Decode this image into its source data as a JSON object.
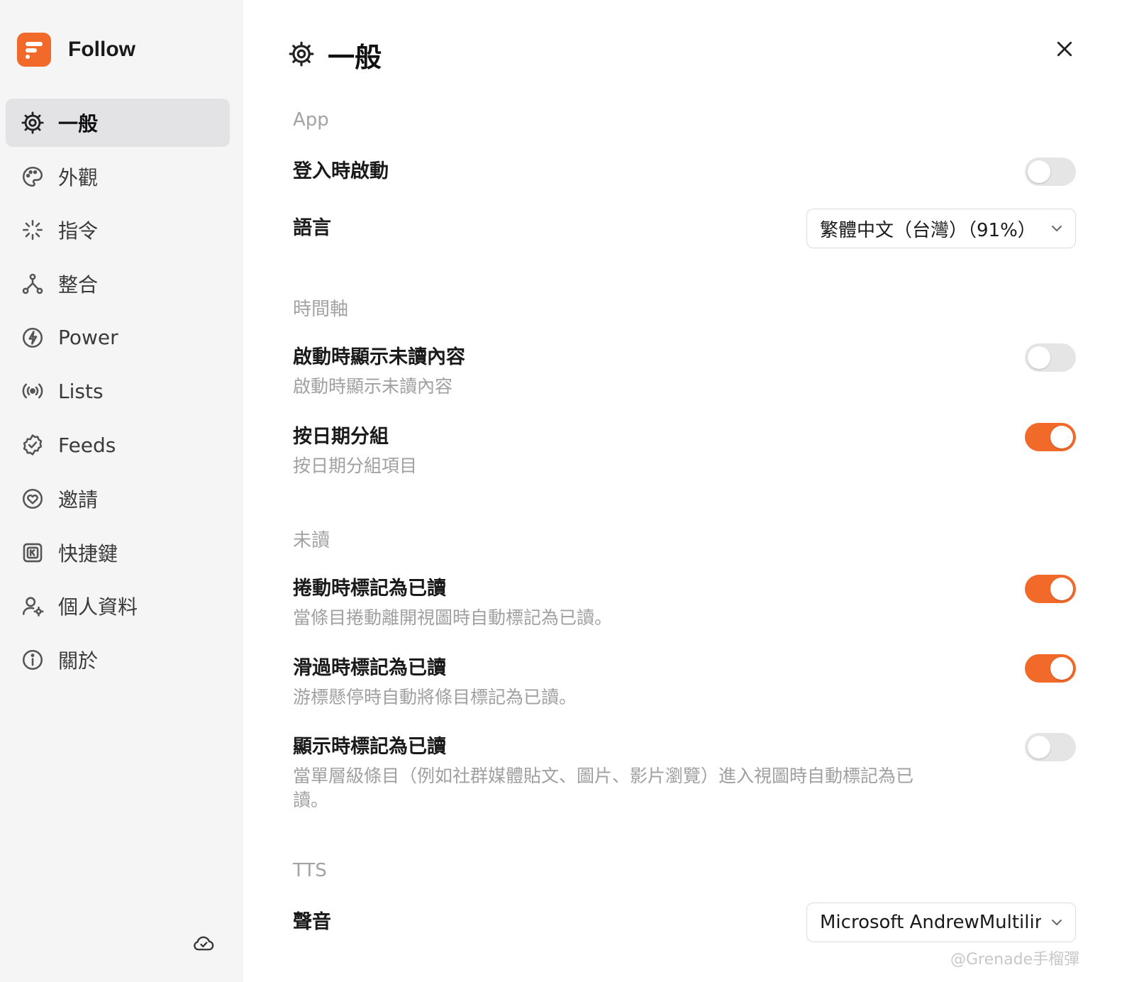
{
  "brand": {
    "name": "Follow"
  },
  "sidebar": {
    "items": [
      {
        "label": "一般",
        "icon": "gear-icon",
        "active": true
      },
      {
        "label": "外觀",
        "icon": "palette-icon"
      },
      {
        "label": "指令",
        "icon": "sparkle-icon"
      },
      {
        "label": "整合",
        "icon": "integration-icon"
      },
      {
        "label": "Power",
        "icon": "power-icon"
      },
      {
        "label": "Lists",
        "icon": "broadcast-icon"
      },
      {
        "label": "Feeds",
        "icon": "badge-check-icon"
      },
      {
        "label": "邀請",
        "icon": "heart-icon"
      },
      {
        "label": "快捷鍵",
        "icon": "keyboard-icon"
      },
      {
        "label": "個人資料",
        "icon": "user-settings-icon"
      },
      {
        "label": "關於",
        "icon": "info-icon"
      }
    ]
  },
  "page": {
    "title": "一般"
  },
  "sections": {
    "app": {
      "title": "App",
      "launch_at_login": {
        "label": "登入時啟動",
        "enabled": false
      },
      "language": {
        "label": "語言",
        "value": "繁體中文（台灣）（91%）"
      }
    },
    "timeline": {
      "title": "時間軸",
      "show_unread_on_launch": {
        "label": "啟動時顯示未讀內容",
        "desc": "啟動時顯示未讀內容",
        "enabled": false
      },
      "group_by_date": {
        "label": "按日期分組",
        "desc": "按日期分組項目",
        "enabled": true
      }
    },
    "unread": {
      "title": "未讀",
      "mark_on_scroll": {
        "label": "捲動時標記為已讀",
        "desc": "當條目捲動離開視圖時自動標記為已讀。",
        "enabled": true
      },
      "mark_on_hover": {
        "label": "滑過時標記為已讀",
        "desc": "游標懸停時自動將條目標記為已讀。",
        "enabled": true
      },
      "mark_on_render": {
        "label": "顯示時標記為已讀",
        "desc": "當單層級條目（例如社群媒體貼文、圖片、影片瀏覽）進入視圖時自動標記為已讀。",
        "enabled": false
      }
    },
    "tts": {
      "title": "TTS",
      "voice": {
        "label": "聲音",
        "value": "Microsoft AndrewMultilingual"
      }
    }
  },
  "watermark": "@Grenade手榴彈",
  "colors": {
    "accent": "#f26a2a",
    "sidebar_bg": "#f5f5f5",
    "active_item_bg": "#e3e3e6"
  }
}
